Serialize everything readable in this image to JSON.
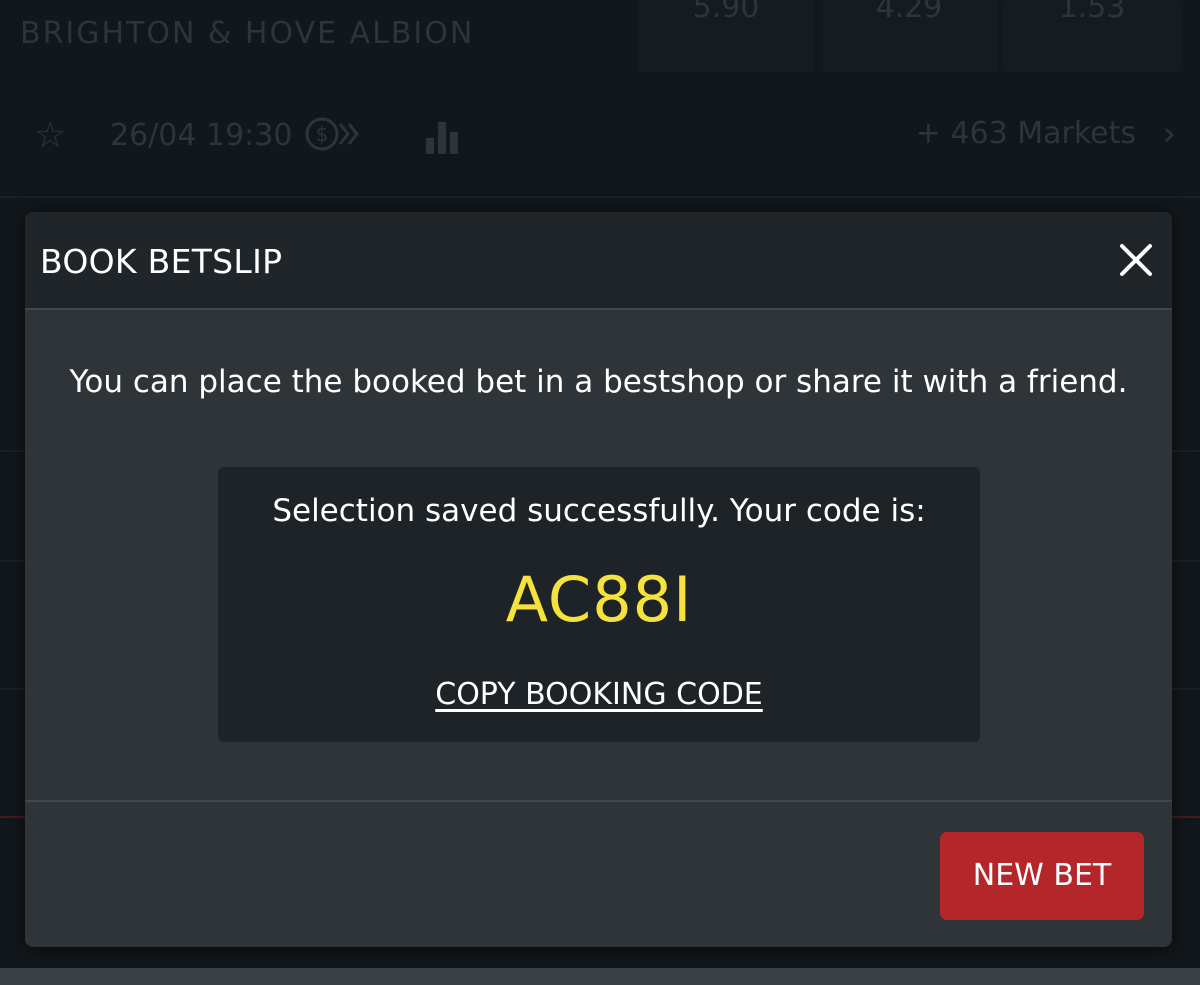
{
  "background": {
    "team_name": "BRIGHTON & HOVE ALBION",
    "odds": [
      "5.90",
      "4.29",
      "1.53"
    ],
    "match_time": "26/04 19:30",
    "markets_label": "+ 463  Markets"
  },
  "modal": {
    "title": "BOOK BETSLIP",
    "info_text": "You can place the booked bet in a bestshop or share it with a friend.",
    "code_caption": "Selection saved successfully. Your code is:",
    "booking_code": "AC88I",
    "copy_label": "COPY BOOKING CODE",
    "new_bet_label": "NEW BET"
  },
  "colors": {
    "accent_code": "#f5e23e",
    "primary_button": "#b5262b",
    "modal_bg": "#2e3438",
    "header_bg": "#1f2529"
  },
  "icons": [
    "star-icon",
    "cashout-icon",
    "stats-icon",
    "chevron-right-icon",
    "close-icon"
  ]
}
